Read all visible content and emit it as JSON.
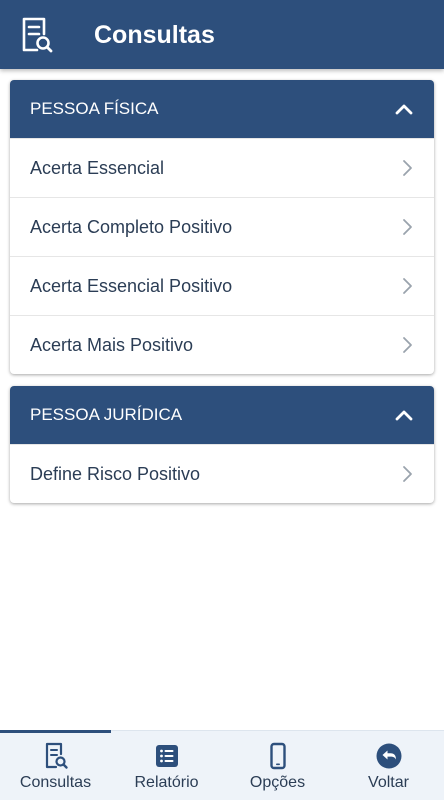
{
  "header": {
    "title": "Consultas",
    "icon": "document-search-icon"
  },
  "sections": [
    {
      "title": "PESSOA FÍSICA",
      "expanded": true,
      "items": [
        {
          "label": "Acerta Essencial"
        },
        {
          "label": "Acerta Completo Positivo"
        },
        {
          "label": "Acerta Essencial Positivo"
        },
        {
          "label": "Acerta Mais Positivo"
        }
      ]
    },
    {
      "title": "PESSOA JURÍDICA",
      "expanded": true,
      "items": [
        {
          "label": "Define Risco Positivo"
        }
      ]
    }
  ],
  "bottom_nav": {
    "active": "Consultas",
    "items": [
      {
        "label": "Consultas",
        "icon": "document-search-icon"
      },
      {
        "label": "Relatório",
        "icon": "list-icon"
      },
      {
        "label": "Opções",
        "icon": "phone-icon"
      },
      {
        "label": "Voltar",
        "icon": "back-arrow-icon"
      }
    ]
  },
  "colors": {
    "primary": "#2d4f7c",
    "text": "#2b3d55",
    "chevron": "#9aa3ad",
    "nav_background": "#eef3f9"
  }
}
